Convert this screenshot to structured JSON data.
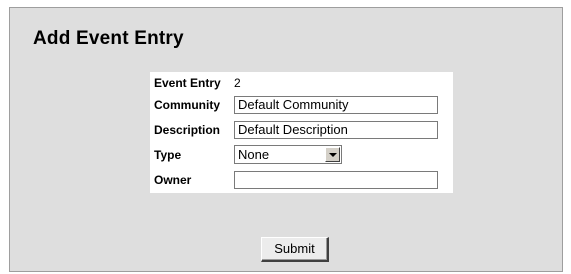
{
  "page": {
    "title": "Add Event Entry"
  },
  "form": {
    "event_entry": {
      "label": "Event Entry",
      "value": "2"
    },
    "community": {
      "label": "Community",
      "value": "Default Community"
    },
    "description": {
      "label": "Description",
      "value": "Default Description"
    },
    "type": {
      "label": "Type",
      "selected": "None"
    },
    "owner": {
      "label": "Owner",
      "value": ""
    }
  },
  "actions": {
    "submit_label": "Submit"
  }
}
